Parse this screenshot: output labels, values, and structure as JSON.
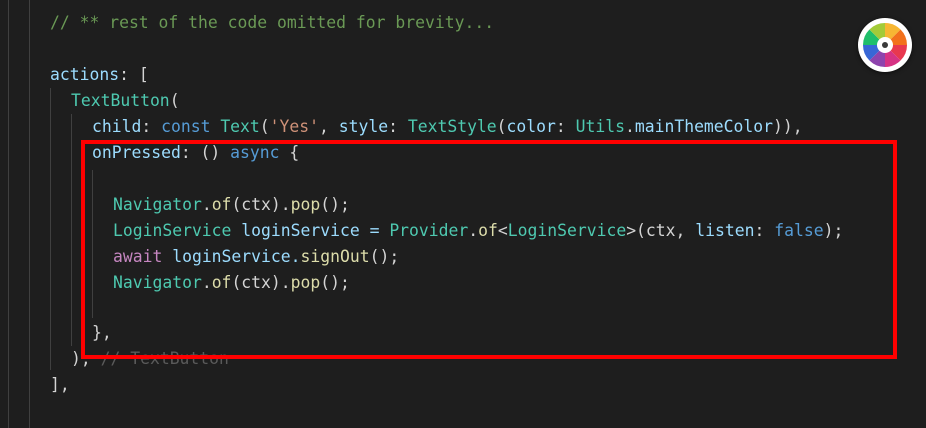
{
  "code": {
    "line_comment": "// ** rest of the code omitted for brevity...",
    "actions_key": "actions",
    "actions_punct": ": [",
    "textbutton_class": "TextButton",
    "textbutton_open": "(",
    "child_key": "child",
    "child_colon": ": ",
    "const_kw": "const",
    "space": " ",
    "text_class": "Text",
    "text_open": "(",
    "yes_string": "'Yes'",
    "comma_space": ", ",
    "style_key": "style",
    "style_colon": ": ",
    "textstyle_class": "TextStyle",
    "textstyle_open": "(",
    "color_key": "color",
    "color_colon": ": ",
    "utils_class": "Utils",
    "dot": ".",
    "main_theme_color": "mainThemeColor",
    "child_close": ")),",
    "onpressed_key": "onPressed",
    "onpressed_colon": ": () ",
    "async_kw": "async",
    "brace_open": " {",
    "navigator_class": "Navigator",
    "of_fn": "of",
    "ctx_paren": "(ctx).",
    "pop_fn": "pop",
    "pop_close": "();",
    "loginservice_class": "LoginService",
    "loginservice_var": " loginService = ",
    "provider_class": "Provider",
    "lt": "<",
    "gt_ctx": ">(ctx, ",
    "listen_key": "listen",
    "listen_colon": ": ",
    "false_kw": "false",
    "line_end_paren": ");",
    "await_kw": "await",
    "loginservice_ref": " loginService.",
    "signout_fn": "signOut",
    "signout_close": "();",
    "closing_brace": "},",
    "closing_paren": "),",
    "closing_comment": " // TextButton",
    "closing_bracket": "],"
  },
  "colors": {
    "background": "#1e1e1e",
    "highlight_border": "#ff0000"
  }
}
